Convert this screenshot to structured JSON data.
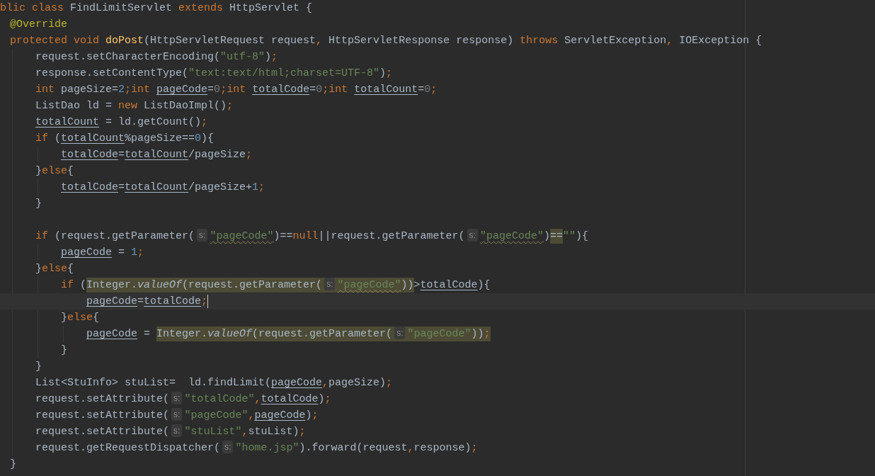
{
  "editor": {
    "lines": [
      {
        "kind": "code",
        "tokens": [
          {
            "kind": "keyword",
            "text": "blic class"
          },
          {
            "kind": "plain",
            "text": " FindLimitServlet "
          },
          {
            "kind": "keyword",
            "text": "extends"
          },
          {
            "kind": "plain",
            "text": " HttpServlet {"
          }
        ],
        "children": [
          {
            "kind": "code",
            "tokens": [
              {
                "kind": "annotation",
                "text": "@Override"
              }
            ]
          },
          {
            "kind": "code",
            "tokens": [
              {
                "kind": "keyword",
                "text": "protected void "
              },
              {
                "kind": "method",
                "text": "doPost"
              },
              {
                "kind": "plain",
                "text": "(HttpServletRequest request"
              },
              {
                "kind": "punct",
                "text": ","
              },
              {
                "kind": "plain",
                "text": " HttpServletResponse response) "
              },
              {
                "kind": "keyword",
                "text": "throws"
              },
              {
                "kind": "plain",
                "text": " ServletException"
              },
              {
                "kind": "punct",
                "text": ","
              },
              {
                "kind": "plain",
                "text": " IOException {"
              }
            ],
            "children": [
              {
                "kind": "code",
                "tokens": [
                  {
                    "kind": "plain",
                    "text": "request.setCharacterEncoding("
                  },
                  {
                    "kind": "string",
                    "text": "\"utf-8\""
                  },
                  {
                    "kind": "plain",
                    "text": ")"
                  },
                  {
                    "kind": "punct",
                    "text": ";"
                  }
                ]
              },
              {
                "kind": "code",
                "tokens": [
                  {
                    "kind": "plain",
                    "text": "response.setContentType("
                  },
                  {
                    "kind": "string",
                    "text": "\"text:text/html;charset=UTF-8\""
                  },
                  {
                    "kind": "plain",
                    "text": ")"
                  },
                  {
                    "kind": "punct",
                    "text": ";"
                  }
                ]
              },
              {
                "kind": "code",
                "tokens": [
                  {
                    "kind": "keyword",
                    "text": "int "
                  },
                  {
                    "kind": "plain",
                    "text": "pageSize="
                  },
                  {
                    "kind": "number",
                    "text": "2"
                  },
                  {
                    "kind": "punct",
                    "text": ";"
                  },
                  {
                    "kind": "keyword",
                    "text": "int "
                  },
                  {
                    "kind": "variable",
                    "text": "pageCode"
                  },
                  {
                    "kind": "plain",
                    "text": "="
                  },
                  {
                    "kind": "unused",
                    "text": "0"
                  },
                  {
                    "kind": "punct",
                    "text": ";"
                  },
                  {
                    "kind": "keyword",
                    "text": "int "
                  },
                  {
                    "kind": "variable",
                    "text": "totalCode"
                  },
                  {
                    "kind": "plain",
                    "text": "="
                  },
                  {
                    "kind": "unused",
                    "text": "0"
                  },
                  {
                    "kind": "punct",
                    "text": ";"
                  },
                  {
                    "kind": "keyword",
                    "text": "int "
                  },
                  {
                    "kind": "variable",
                    "text": "totalCount"
                  },
                  {
                    "kind": "plain",
                    "text": "="
                  },
                  {
                    "kind": "unused",
                    "text": "0"
                  },
                  {
                    "kind": "punct",
                    "text": ";"
                  }
                ]
              },
              {
                "kind": "code",
                "tokens": [
                  {
                    "kind": "plain",
                    "text": "ListDao ld = "
                  },
                  {
                    "kind": "keyword",
                    "text": "new"
                  },
                  {
                    "kind": "plain",
                    "text": " ListDaoImpl()"
                  },
                  {
                    "kind": "punct",
                    "text": ";"
                  }
                ]
              },
              {
                "kind": "code",
                "tokens": [
                  {
                    "kind": "variable",
                    "text": "totalCount"
                  },
                  {
                    "kind": "plain",
                    "text": " = ld.getCount()"
                  },
                  {
                    "kind": "punct",
                    "text": ";"
                  }
                ]
              },
              {
                "kind": "code",
                "tokens": [
                  {
                    "kind": "keyword",
                    "text": "if"
                  },
                  {
                    "kind": "plain",
                    "text": " ("
                  },
                  {
                    "kind": "variable",
                    "text": "totalCount"
                  },
                  {
                    "kind": "plain",
                    "text": "%pageSize=="
                  },
                  {
                    "kind": "number",
                    "text": "0"
                  },
                  {
                    "kind": "plain",
                    "text": "){"
                  }
                ],
                "children": [
                  {
                    "kind": "code",
                    "tokens": [
                      {
                        "kind": "variable",
                        "text": "totalCode"
                      },
                      {
                        "kind": "plain",
                        "text": "="
                      },
                      {
                        "kind": "variable",
                        "text": "totalCount"
                      },
                      {
                        "kind": "plain",
                        "text": "/pageSize"
                      },
                      {
                        "kind": "punct",
                        "text": ";"
                      }
                    ]
                  }
                ]
              },
              {
                "kind": "code",
                "tokens": [
                  {
                    "kind": "plain",
                    "text": "}"
                  },
                  {
                    "kind": "keyword",
                    "text": "else"
                  },
                  {
                    "kind": "plain",
                    "text": "{"
                  }
                ],
                "children": [
                  {
                    "kind": "code",
                    "tokens": [
                      {
                        "kind": "variable",
                        "text": "totalCode"
                      },
                      {
                        "kind": "plain",
                        "text": "="
                      },
                      {
                        "kind": "variable",
                        "text": "totalCount"
                      },
                      {
                        "kind": "plain",
                        "text": "/pageSize+"
                      },
                      {
                        "kind": "number",
                        "text": "1"
                      },
                      {
                        "kind": "punct",
                        "text": ";"
                      }
                    ]
                  }
                ]
              },
              {
                "kind": "code",
                "tokens": [
                  {
                    "kind": "plain",
                    "text": "}"
                  }
                ]
              },
              {
                "kind": "blank"
              },
              {
                "kind": "code",
                "tokens": [
                  {
                    "kind": "keyword",
                    "text": "if"
                  },
                  {
                    "kind": "plain",
                    "text": " (request.getParameter("
                  },
                  {
                    "kind": "hint",
                    "text": "s:"
                  },
                  {
                    "kind": "flagged",
                    "text": "\"pageCode\""
                  },
                  {
                    "kind": "plain",
                    "text": ")=="
                  },
                  {
                    "kind": "keyword",
                    "text": "null"
                  },
                  {
                    "kind": "plain",
                    "text": "||request.getParameter("
                  },
                  {
                    "kind": "hint",
                    "text": "s:"
                  },
                  {
                    "kind": "flagged",
                    "text": "\"pageCode\""
                  },
                  {
                    "kind": "plain",
                    "text": ")"
                  },
                  {
                    "kind": "highlight",
                    "tokens": [
                      {
                        "kind": "plain",
                        "text": "=="
                      }
                    ]
                  },
                  {
                    "kind": "string",
                    "text": "\"\""
                  },
                  {
                    "kind": "plain",
                    "text": "){"
                  }
                ],
                "children": [
                  {
                    "kind": "code",
                    "tokens": [
                      {
                        "kind": "variable",
                        "text": "pageCode"
                      },
                      {
                        "kind": "plain",
                        "text": " = "
                      },
                      {
                        "kind": "number",
                        "text": "1"
                      },
                      {
                        "kind": "punct",
                        "text": ";"
                      }
                    ]
                  }
                ]
              },
              {
                "kind": "code",
                "tokens": [
                  {
                    "kind": "plain",
                    "text": "}"
                  },
                  {
                    "kind": "keyword",
                    "text": "else"
                  },
                  {
                    "kind": "plain",
                    "text": "{"
                  }
                ],
                "children": [
                  {
                    "kind": "code",
                    "tokens": [
                      {
                        "kind": "keyword",
                        "text": "if"
                      },
                      {
                        "kind": "plain",
                        "text": " ("
                      },
                      {
                        "kind": "highlight",
                        "tokens": [
                          {
                            "kind": "plain",
                            "text": "Integer."
                          },
                          {
                            "kind": "static",
                            "text": "valueOf"
                          },
                          {
                            "kind": "plain",
                            "text": "(request.getParameter("
                          },
                          {
                            "kind": "hint",
                            "text": "s:"
                          },
                          {
                            "kind": "flagged",
                            "text": "\"pageCode\""
                          },
                          {
                            "kind": "plain",
                            "text": "))"
                          }
                        ]
                      },
                      {
                        "kind": "plain",
                        "text": ">"
                      },
                      {
                        "kind": "variable",
                        "text": "totalCode"
                      },
                      {
                        "kind": "plain",
                        "text": "){"
                      }
                    ],
                    "children": [
                      {
                        "kind": "current",
                        "tokens": [
                          {
                            "kind": "variable",
                            "text": "pageCode"
                          },
                          {
                            "kind": "plain",
                            "text": "="
                          },
                          {
                            "kind": "variable",
                            "text": "totalCode"
                          },
                          {
                            "kind": "punct",
                            "text": ";"
                          }
                        ]
                      }
                    ]
                  },
                  {
                    "kind": "code",
                    "tokens": [
                      {
                        "kind": "plain",
                        "text": "}"
                      },
                      {
                        "kind": "keyword",
                        "text": "else"
                      },
                      {
                        "kind": "plain",
                        "text": "{"
                      }
                    ],
                    "children": [
                      {
                        "kind": "code",
                        "tokens": [
                          {
                            "kind": "variable",
                            "text": "pageCode"
                          },
                          {
                            "kind": "plain",
                            "text": " = "
                          },
                          {
                            "kind": "highlight",
                            "tokens": [
                              {
                                "kind": "plain",
                                "text": "Integer."
                              },
                              {
                                "kind": "static",
                                "text": "valueOf"
                              },
                              {
                                "kind": "plain",
                                "text": "(request.getParameter("
                              },
                              {
                                "kind": "hint",
                                "text": "s:"
                              },
                              {
                                "kind": "string",
                                "text": "\"pageCode\""
                              },
                              {
                                "kind": "plain",
                                "text": "))"
                              },
                              {
                                "kind": "punct",
                                "text": ";"
                              }
                            ]
                          }
                        ]
                      }
                    ]
                  },
                  {
                    "kind": "code",
                    "tokens": [
                      {
                        "kind": "plain",
                        "text": "}"
                      }
                    ]
                  }
                ]
              },
              {
                "kind": "code",
                "tokens": [
                  {
                    "kind": "plain",
                    "text": "}"
                  }
                ]
              },
              {
                "kind": "code",
                "tokens": [
                  {
                    "kind": "plain",
                    "text": "List<StuInfo> stuList=  ld.findLimit("
                  },
                  {
                    "kind": "variable",
                    "text": "pageCode"
                  },
                  {
                    "kind": "punct",
                    "text": ","
                  },
                  {
                    "kind": "plain",
                    "text": "pageSize)"
                  },
                  {
                    "kind": "punct",
                    "text": ";"
                  }
                ]
              },
              {
                "kind": "code",
                "tokens": [
                  {
                    "kind": "plain",
                    "text": "request.setAttribute("
                  },
                  {
                    "kind": "hint",
                    "text": "s:"
                  },
                  {
                    "kind": "string",
                    "text": "\"totalCode\""
                  },
                  {
                    "kind": "punct",
                    "text": ","
                  },
                  {
                    "kind": "variable",
                    "text": "totalCode"
                  },
                  {
                    "kind": "plain",
                    "text": ")"
                  },
                  {
                    "kind": "punct",
                    "text": ";"
                  }
                ]
              },
              {
                "kind": "code",
                "tokens": [
                  {
                    "kind": "plain",
                    "text": "request.setAttribute("
                  },
                  {
                    "kind": "hint",
                    "text": "s:"
                  },
                  {
                    "kind": "string",
                    "text": "\"pageCode\""
                  },
                  {
                    "kind": "punct",
                    "text": ","
                  },
                  {
                    "kind": "variable",
                    "text": "pageCode"
                  },
                  {
                    "kind": "plain",
                    "text": ")"
                  },
                  {
                    "kind": "punct",
                    "text": ";"
                  }
                ]
              },
              {
                "kind": "code",
                "tokens": [
                  {
                    "kind": "plain",
                    "text": "request.setAttribute("
                  },
                  {
                    "kind": "hint",
                    "text": "s:"
                  },
                  {
                    "kind": "string",
                    "text": "\"stuList\""
                  },
                  {
                    "kind": "punct",
                    "text": ","
                  },
                  {
                    "kind": "plain",
                    "text": "stuList)"
                  },
                  {
                    "kind": "punct",
                    "text": ";"
                  }
                ]
              },
              {
                "kind": "code",
                "tokens": [
                  {
                    "kind": "plain",
                    "text": "request.getRequestDispatcher("
                  },
                  {
                    "kind": "hint",
                    "text": "s:"
                  },
                  {
                    "kind": "string",
                    "text": "\"home.jsp\""
                  },
                  {
                    "kind": "plain",
                    "text": ").forward(request"
                  },
                  {
                    "kind": "punct",
                    "text": ","
                  },
                  {
                    "kind": "plain",
                    "text": "response)"
                  },
                  {
                    "kind": "punct",
                    "text": ";"
                  }
                ]
              }
            ]
          },
          {
            "kind": "code",
            "tokens": [
              {
                "kind": "plain",
                "text": "}"
              }
            ]
          }
        ]
      }
    ]
  }
}
